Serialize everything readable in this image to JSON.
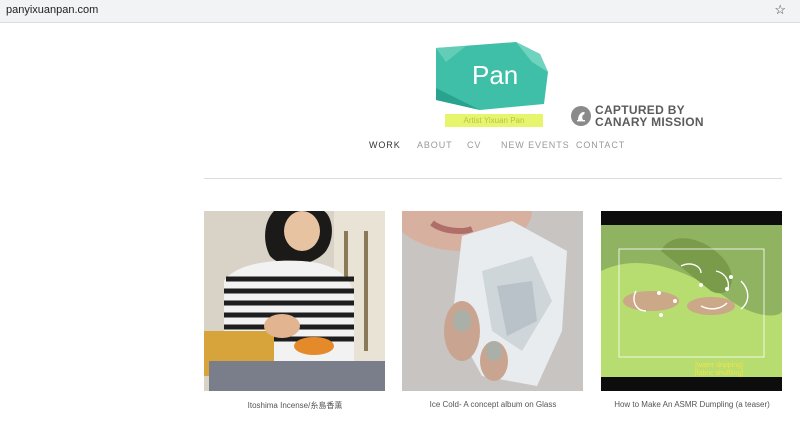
{
  "browser": {
    "url": "panyixuanpan.com"
  },
  "logo": {
    "text": "Pan",
    "tagline": "Artist Yixuan Pan"
  },
  "canary": {
    "line1": "CAPTURED BY",
    "line2": "CANARY MISSION"
  },
  "nav": [
    {
      "label": "WORK",
      "active": true
    },
    {
      "label": "ABOUT",
      "active": false
    },
    {
      "label": "CV",
      "active": false
    },
    {
      "label": "NEW EVENTS",
      "active": false
    },
    {
      "label": "CONTACT",
      "active": false
    }
  ],
  "works": [
    {
      "caption": "Itoshima Incense/糸島香薫"
    },
    {
      "caption": "Ice Cold- A concept album on Glass"
    },
    {
      "caption": "How to Make An ASMR Dumpling (a teaser)",
      "overlay_text": [
        "[water dripping]",
        "[fabric shuffling]"
      ]
    }
  ],
  "colors": {
    "logo_teal": "#3fbfa7",
    "logo_dark": "#2aa38e",
    "tagline_bg": "#e7f56d"
  }
}
